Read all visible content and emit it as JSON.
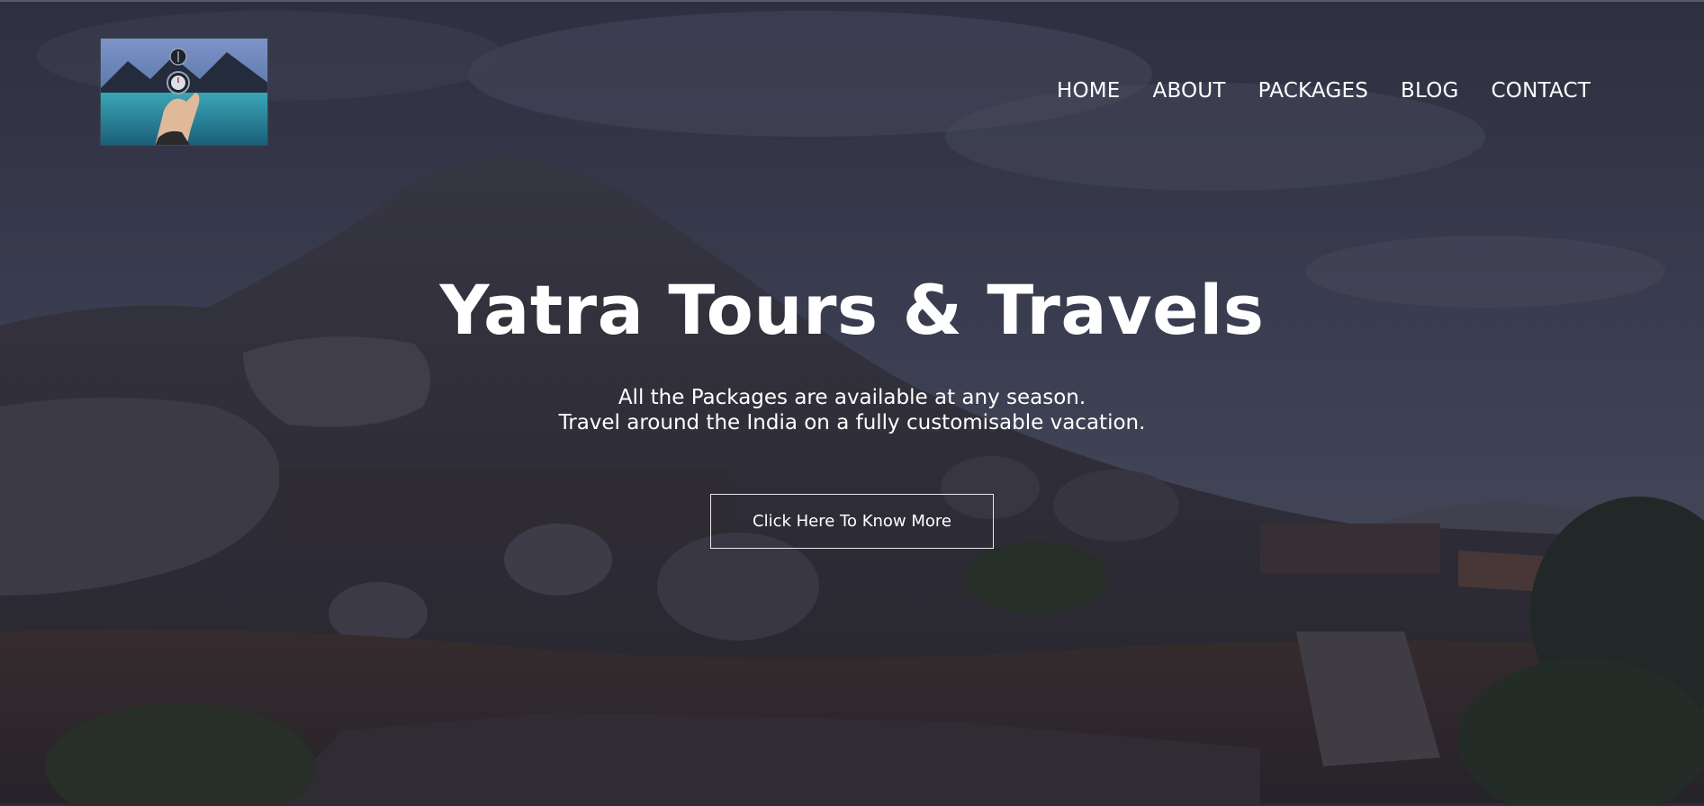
{
  "nav": {
    "items": [
      {
        "label": "HOME"
      },
      {
        "label": "ABOUT"
      },
      {
        "label": "PACKAGES"
      },
      {
        "label": "BLOG"
      },
      {
        "label": "CONTACT"
      }
    ]
  },
  "hero": {
    "title": "Yatra Tours & Travels",
    "subtitle_line1": "All the Packages are available at any season.",
    "subtitle_line2": "Travel around the India on a fully customisable vacation.",
    "cta_label": "Click Here To Know More"
  },
  "logo": {
    "icon": "compass-in-hand-icon"
  },
  "colors": {
    "overlay": "#16162480",
    "text": "#ffffff",
    "button_border": "#e8e8ea"
  }
}
